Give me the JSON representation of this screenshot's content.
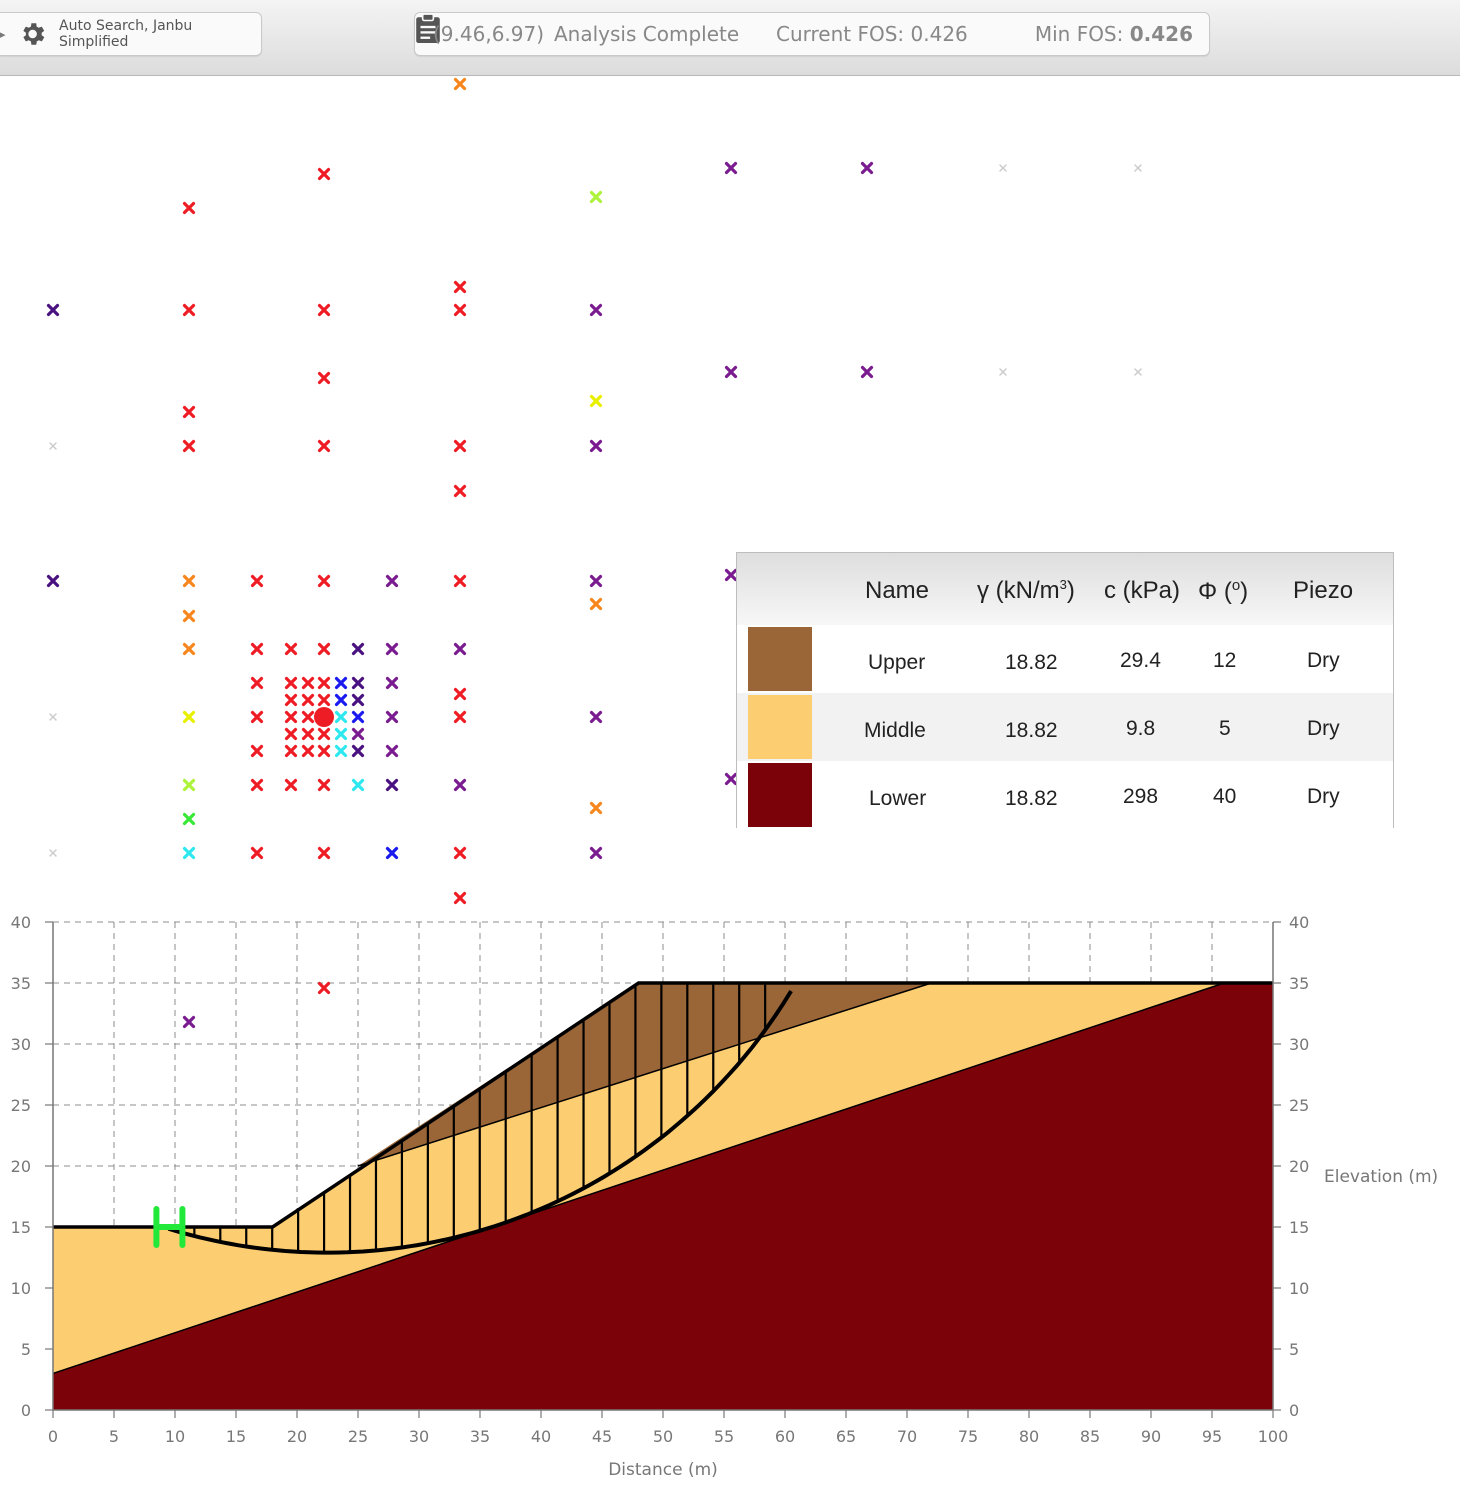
{
  "toolbar": {
    "settings_label": "Auto Search, Janbu Simplified",
    "coordinates": "(9.46,6.97)",
    "status_message": "Analysis Complete",
    "current_fos_label": "Current FOS: 0.426",
    "min_fos_label": "Min FOS:",
    "min_fos_value": "0.426"
  },
  "legend": {
    "headers": {
      "name": "Name",
      "gamma": "γ (kN/m",
      "gamma_sup": "3",
      "gamma_end": ")",
      "c": "c (kPa)",
      "phi": "Φ (",
      "phi_sup": "o",
      "phi_end": ")",
      "piezo": "Piezo"
    },
    "materials": [
      {
        "name": "Upper",
        "gamma": "18.82",
        "c": "29.4",
        "phi": "12",
        "piezo": "Dry",
        "color": "#9a6638"
      },
      {
        "name": "Middle",
        "gamma": "18.82",
        "c": "9.8",
        "phi": "5",
        "piezo": "Dry",
        "color": "#fdcd72"
      },
      {
        "name": "Lower",
        "gamma": "18.82",
        "c": "298",
        "phi": "40",
        "piezo": "Dry",
        "color": "#7b0208"
      }
    ]
  },
  "chart_data": {
    "type": "cross-section",
    "xlabel": "Distance (m)",
    "ylabel": "Elevation (m)",
    "xlim": [
      0,
      100
    ],
    "ylim": [
      0,
      40
    ],
    "x_ticks": [
      0,
      5,
      10,
      15,
      20,
      25,
      30,
      35,
      40,
      45,
      50,
      55,
      60,
      65,
      70,
      75,
      80,
      85,
      90,
      95,
      100
    ],
    "y_ticks": [
      0,
      5,
      10,
      15,
      20,
      25,
      30,
      35,
      40
    ],
    "grid": true,
    "ground_surface": [
      [
        0,
        15
      ],
      [
        18,
        15
      ],
      [
        48,
        35
      ],
      [
        100,
        35
      ]
    ],
    "layers": [
      {
        "name": "Lower",
        "boundary": [
          [
            0,
            3
          ],
          [
            96,
            35
          ],
          [
            100,
            35
          ]
        ]
      },
      {
        "name": "Middle",
        "boundary": [
          [
            25,
            20
          ],
          [
            72,
            35
          ]
        ]
      },
      {
        "name": "Upper",
        "boundary": [
          [
            48,
            35
          ],
          [
            100,
            35
          ]
        ]
      }
    ],
    "critical_surface": {
      "entry_x": 9.46,
      "exit_x": 60.5,
      "lowest_elevation": 12.9
    },
    "critical_center": [
      22.5,
      57.3
    ],
    "slices_count": 24,
    "search_grid_colors": [
      "#ee1c24",
      "#f7861c",
      "#7a1b8f",
      "#4a1280",
      "#1b1bf0",
      "#2ee8f0",
      "#adf23b",
      "#e8f000",
      "#37e837",
      "#cccccc"
    ]
  }
}
